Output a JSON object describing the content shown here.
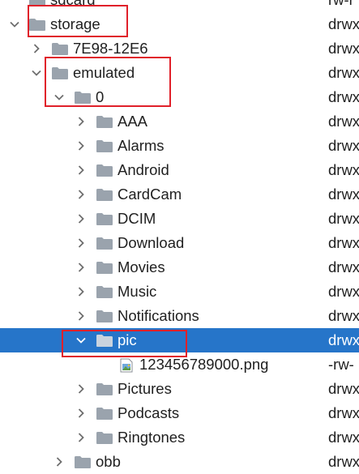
{
  "tree": {
    "rows": [
      {
        "label": "sdcard",
        "perm": "rw-r",
        "icon": "folder-icon",
        "chevron": "none",
        "selected": false
      },
      {
        "label": "storage",
        "perm": "drwx",
        "icon": "folder-icon",
        "chevron": "expanded",
        "selected": false
      },
      {
        "label": "7E98-12E6",
        "perm": "drwx",
        "icon": "folder-icon",
        "chevron": "collapsed",
        "selected": false
      },
      {
        "label": "emulated",
        "perm": "drwx",
        "icon": "folder-icon",
        "chevron": "expanded",
        "selected": false
      },
      {
        "label": "0",
        "perm": "drwx",
        "icon": "folder-icon",
        "chevron": "expanded",
        "selected": false
      },
      {
        "label": "AAA",
        "perm": "drwx",
        "icon": "folder-icon",
        "chevron": "collapsed",
        "selected": false
      },
      {
        "label": "Alarms",
        "perm": "drwx",
        "icon": "folder-icon",
        "chevron": "collapsed",
        "selected": false
      },
      {
        "label": "Android",
        "perm": "drwx",
        "icon": "folder-icon",
        "chevron": "collapsed",
        "selected": false
      },
      {
        "label": "CardCam",
        "perm": "drwx",
        "icon": "folder-icon",
        "chevron": "collapsed",
        "selected": false
      },
      {
        "label": "DCIM",
        "perm": "drwx",
        "icon": "folder-icon",
        "chevron": "collapsed",
        "selected": false
      },
      {
        "label": "Download",
        "perm": "drwx",
        "icon": "folder-icon",
        "chevron": "collapsed",
        "selected": false
      },
      {
        "label": "Movies",
        "perm": "drwx",
        "icon": "folder-icon",
        "chevron": "collapsed",
        "selected": false
      },
      {
        "label": "Music",
        "perm": "drwx",
        "icon": "folder-icon",
        "chevron": "collapsed",
        "selected": false
      },
      {
        "label": "Notifications",
        "perm": "drwx",
        "icon": "folder-icon",
        "chevron": "collapsed",
        "selected": false
      },
      {
        "label": "pic",
        "perm": "drwx",
        "icon": "folder-icon",
        "chevron": "expanded",
        "selected": true
      },
      {
        "label": "123456789000.png",
        "perm": "-rw-",
        "icon": "image-file-icon",
        "chevron": "none",
        "selected": false
      },
      {
        "label": "Pictures",
        "perm": "drwx",
        "icon": "folder-icon",
        "chevron": "collapsed",
        "selected": false
      },
      {
        "label": "Podcasts",
        "perm": "drwx",
        "icon": "folder-icon",
        "chevron": "collapsed",
        "selected": false
      },
      {
        "label": "Ringtones",
        "perm": "drwx",
        "icon": "folder-icon",
        "chevron": "collapsed",
        "selected": false
      },
      {
        "label": "obb",
        "perm": "drwx",
        "icon": "folder-icon",
        "chevron": "collapsed",
        "selected": false
      }
    ]
  },
  "colors": {
    "selection": "#2675c9",
    "annotation": "#e0202a",
    "folder": "#9aa3ad",
    "chevron": "#6e6e6e"
  }
}
